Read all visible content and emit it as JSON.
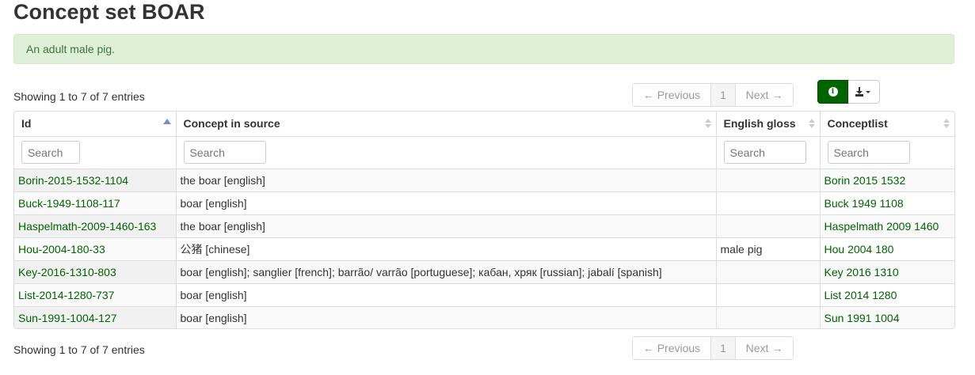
{
  "page": {
    "title": "Concept set BOAR"
  },
  "alert": {
    "text": "An adult male pig."
  },
  "info": {
    "top": "Showing 1 to 7 of 7 entries",
    "bottom": "Showing 1 to 7 of 7 entries"
  },
  "pager": {
    "previous": "← Previous",
    "page": "1",
    "next": "Next →"
  },
  "toolbar": {
    "info_icon": "info-icon",
    "download_icon": "download-icon",
    "accent": "#006400"
  },
  "table": {
    "columns": [
      "Id",
      "Concept in source",
      "English gloss",
      "Conceptlist"
    ],
    "search_placeholder": "Search",
    "rows": [
      {
        "id": "Borin-2015-1532-1104",
        "concept": "the boar [english]",
        "gloss": "",
        "conceptlist": "Borin 2015 1532"
      },
      {
        "id": "Buck-1949-1108-117",
        "concept": "boar [english]",
        "gloss": "",
        "conceptlist": "Buck 1949 1108"
      },
      {
        "id": "Haspelmath-2009-1460-163",
        "concept": "the boar [english]",
        "gloss": "",
        "conceptlist": "Haspelmath 2009 1460"
      },
      {
        "id": "Hou-2004-180-33",
        "concept": "公猪 [chinese]",
        "gloss": "male pig",
        "conceptlist": "Hou 2004 180"
      },
      {
        "id": "Key-2016-1310-803",
        "concept": "boar [english]; sanglier [french]; barrão/ varrão [portuguese]; кабан, хряк [russian]; jabalí [spanish]",
        "gloss": "",
        "conceptlist": "Key 2016 1310"
      },
      {
        "id": "List-2014-1280-737",
        "concept": "boar [english]",
        "gloss": "",
        "conceptlist": "List 2014 1280"
      },
      {
        "id": "Sun-1991-1004-127",
        "concept": "boar [english]",
        "gloss": "",
        "conceptlist": "Sun 1991 1004"
      }
    ]
  }
}
